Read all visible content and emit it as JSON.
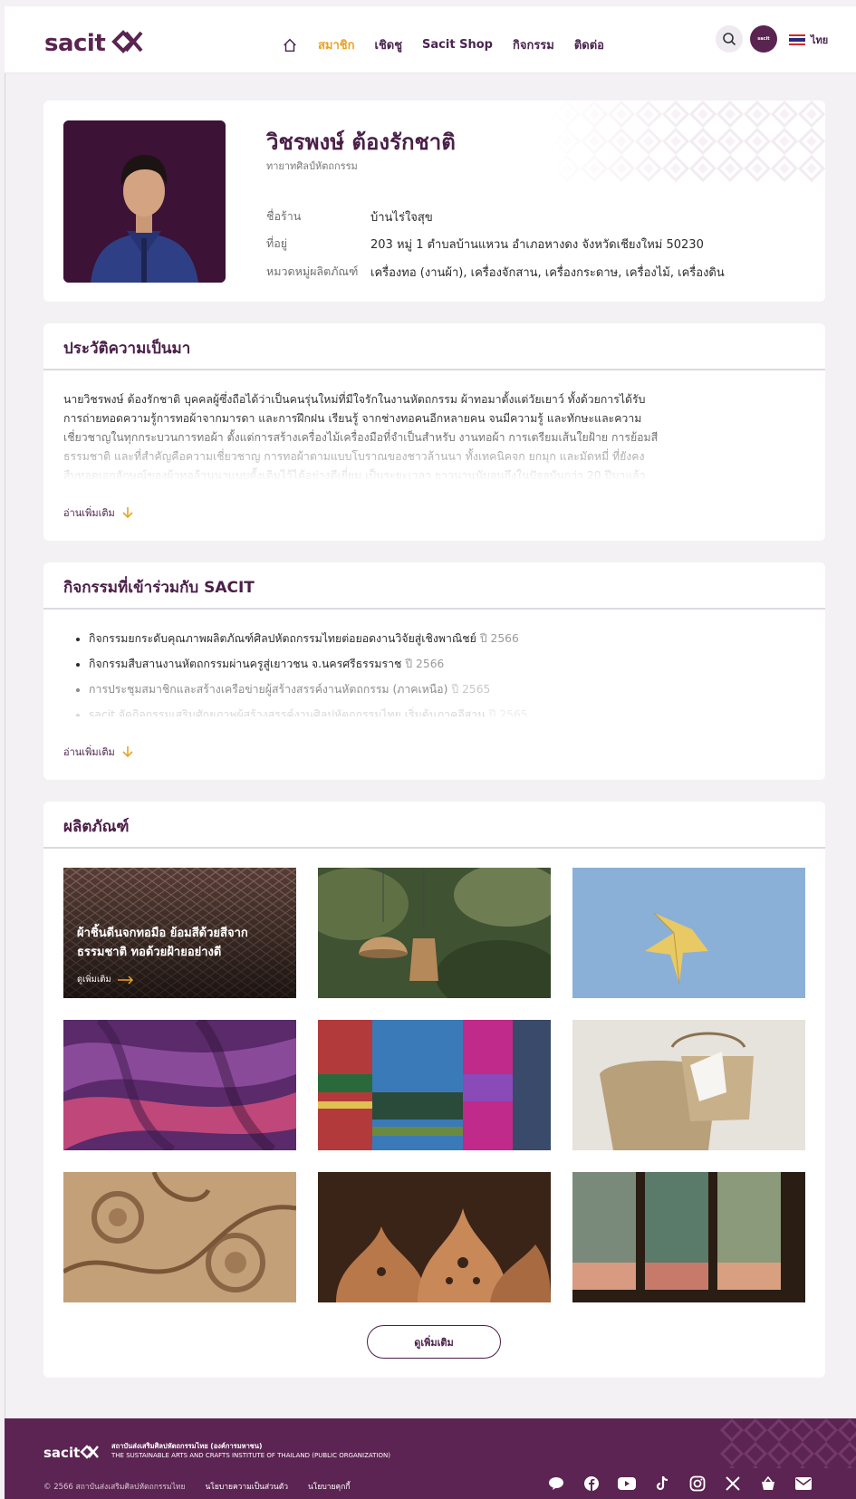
{
  "header": {
    "logo": "sacit",
    "nav": [
      {
        "label": "สมาชิก",
        "active": true
      },
      {
        "label": "เชิดชู",
        "active": false
      },
      {
        "label": "Sacit Shop",
        "active": false
      },
      {
        "label": "กิจกรรม",
        "active": false
      },
      {
        "label": "ติดต่อ",
        "active": false
      }
    ],
    "avatar_text": "sacit",
    "language": "ไทย"
  },
  "profile": {
    "name": "วิชรพงษ์ ต้องรักชาติ",
    "role": "ทายาทศิลป์หัตถกรรม",
    "fields": [
      {
        "key": "ชื่อร้าน",
        "value": "บ้านไร่ใจสุข"
      },
      {
        "key": "ที่อยู่",
        "value": "203 หมู่ 1 ตำบลบ้านแหวน อำเภอหางดง จังหวัดเชียงใหม่ 50230"
      },
      {
        "key": "หมวดหมู่ผลิตภัณฑ์",
        "value": "เครื่องทอ (งานผ้า), เครื่องจักสาน, เครื่องกระดาษ, เครื่องไม้, เครื่องดิน"
      }
    ]
  },
  "history": {
    "title": "ประวัติความเป็นมา",
    "text": "นายวิชรพงษ์ ต้องรักชาติ บุคคลผู้ซึ่งถือได้ว่าเป็นคนรุ่นใหม่ที่มีใจรักในงานหัตถกรรม ผ้าทอมาตั้งแต่วัยเยาว์ ทั้งด้วยการได้รับการถ่ายทอดความรู้การทอผ้าจากมารดา และการฝึกฝน เรียนรู้ จากช่างทอคนอีกหลายคน จนมีความรู้ และทักษะและความ เชี่ยวชาญในทุกกระบวนการทอผ้า ตั้งแต่การสร้างเครื่องไม้เครื่องมือที่จำเป็นสำหรับ งานทอผ้า การเตรียมเส้นใยฝ้าย การย้อมสีธรรมชาติ และที่สำคัญคือความเชี่ยวชาญ การทอผ้าตามแบบโบราณของชาวล้านนา ทั้งเทคนิคจก ยกมุก และมัดหมี่ ที่ยังคงสืบทอดเอกลักษณ์ของผ้าทอล้านนาแบบดั้งเดิมไว้ได้อย่างดีเยี่ยม เป็นระยะเวลา ยาวนานนับจนถึงในปัจจุบันกว่า 20 ปีมาแล้ว",
    "read_more": "อ่านเพิ่มเติม"
  },
  "activities": {
    "title": "กิจกรรมที่เข้าร่วมกับ SACIT",
    "items": [
      {
        "text": "กิจกรรมยกระดับคุณภาพผลิตภัณฑ์ศิลปหัตถกรรมไทยต่อยอดงานวิจัยสู่เชิงพาณิชย์",
        "year": "ปี 2566"
      },
      {
        "text": "กิจกรรมสืบสานงานหัตถกรรมผ่านครูสู่เยาวชน จ.นครศรีธรรมราช",
        "year": "ปี 2566"
      },
      {
        "text": "การประชุมสมาชิกและสร้างเครือข่ายผู้สร้างสรรค์งานหัตถกรรม (ภาคเหนือ)",
        "year": "ปี 2565"
      },
      {
        "text": "sacit จัดกิจกรรมเสริมศักยภาพผู้สร้างสรรค์งานศิลปหัตถกรรมไทย เริ่มต้นภาคอีสาน",
        "year": "ปี 2565"
      }
    ],
    "read_more": "อ่านเพิ่มเติม"
  },
  "products": {
    "title": "ผลิตภัณฑ์",
    "featured_caption": "ผ้าชิ้นดีนจกทอมือ ย้อมสีด้วยสีจากธรรมชาติ ทอด้วยฝ้ายอย่างดี",
    "featured_link": "ดูเพิ่มเติม",
    "see_more": "ดูเพิ่มเติม"
  },
  "footer": {
    "logo": "sacit",
    "org_th": "สถาบันส่งเสริมศิลปหัตถกรรมไทย (องค์การมหาชน)",
    "org_en": "THE SUSTAINABLE ARTS AND CRAFTS INSTITUTE OF THAILAND (PUBLIC ORGANIZATION)",
    "copyright": "© 2566 สถาบันส่งเสริมศิลปหัตถกรรมไทย",
    "privacy": "นโยบายความเป็นส่วนตัว",
    "cookie": "นโยบายคุกกี้"
  },
  "colors": {
    "brand": "#5c2452",
    "accent": "#e9a425"
  },
  "icons": [
    "home-icon",
    "search-icon",
    "line-icon",
    "facebook-icon",
    "youtube-icon",
    "tiktok-icon",
    "instagram-icon",
    "x-icon",
    "shop-icon",
    "mail-icon"
  ]
}
